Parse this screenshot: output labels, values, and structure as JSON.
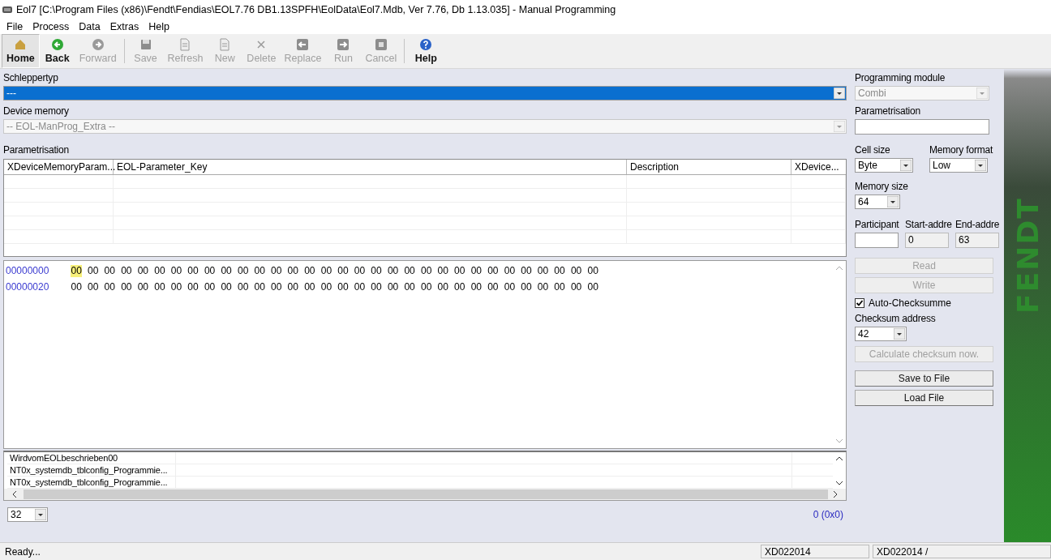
{
  "window": {
    "title": "Eol7 [C:\\Program Files (x86)\\Fendt\\Fendias\\EOL7.76 DB1.13SPFH\\EolData\\Eol7.Mdb, Ver 7.76, Db 1.13.035]  - Manual Programming"
  },
  "menu": [
    "File",
    "Process",
    "Data",
    "Extras",
    "Help"
  ],
  "toolbar": [
    {
      "kind": "home",
      "label": "Home",
      "disabled": false,
      "selected": true,
      "separator_before": false
    },
    {
      "kind": "back",
      "label": "Back",
      "disabled": false,
      "selected": false,
      "separator_before": false
    },
    {
      "kind": "forward",
      "label": "Forward",
      "disabled": true,
      "selected": false,
      "separator_before": false
    },
    {
      "kind": "save",
      "label": "Save",
      "disabled": true,
      "selected": false,
      "separator_before": true
    },
    {
      "kind": "refresh",
      "label": "Refresh",
      "disabled": true,
      "selected": false,
      "separator_before": false
    },
    {
      "kind": "new",
      "label": "New",
      "disabled": true,
      "selected": false,
      "separator_before": false
    },
    {
      "kind": "delete",
      "label": "Delete",
      "disabled": true,
      "selected": false,
      "separator_before": false
    },
    {
      "kind": "replace",
      "label": "Replace",
      "disabled": true,
      "selected": false,
      "separator_before": false
    },
    {
      "kind": "run",
      "label": "Run",
      "disabled": true,
      "selected": false,
      "separator_before": false
    },
    {
      "kind": "cancel",
      "label": "Cancel",
      "disabled": true,
      "selected": false,
      "separator_before": false
    },
    {
      "kind": "help",
      "label": "Help",
      "disabled": false,
      "selected": false,
      "separator_before": true
    }
  ],
  "schleppertyp": {
    "label": "Schleppertyp",
    "value": "---",
    "selected": true,
    "disabled": false
  },
  "device_memory": {
    "label": "Device memory",
    "value": "-- EOL-ManProg_Extra --",
    "disabled": true
  },
  "parametrisation_table": {
    "label": "Parametrisation",
    "columns": [
      "XDeviceMemoryParam...",
      "EOL-Parameter_Key",
      "Description",
      "XDevice..."
    ]
  },
  "hex_view": {
    "rows": [
      {
        "address": "00000000",
        "bytes": [
          {
            "value": "00",
            "selected": true
          },
          {
            "value": "00",
            "selected": false
          },
          {
            "value": "00",
            "selected": false
          },
          {
            "value": "00",
            "selected": false
          },
          {
            "value": "00",
            "selected": false
          },
          {
            "value": "00",
            "selected": false
          },
          {
            "value": "00",
            "selected": false
          },
          {
            "value": "00",
            "selected": false
          },
          {
            "value": "00",
            "selected": false
          },
          {
            "value": "00",
            "selected": false
          },
          {
            "value": "00",
            "selected": false
          },
          {
            "value": "00",
            "selected": false
          },
          {
            "value": "00",
            "selected": false
          },
          {
            "value": "00",
            "selected": false
          },
          {
            "value": "00",
            "selected": false
          },
          {
            "value": "00",
            "selected": false
          },
          {
            "value": "00",
            "selected": false
          },
          {
            "value": "00",
            "selected": false
          },
          {
            "value": "00",
            "selected": false
          },
          {
            "value": "00",
            "selected": false
          },
          {
            "value": "00",
            "selected": false
          },
          {
            "value": "00",
            "selected": false
          },
          {
            "value": "00",
            "selected": false
          },
          {
            "value": "00",
            "selected": false
          },
          {
            "value": "00",
            "selected": false
          },
          {
            "value": "00",
            "selected": false
          },
          {
            "value": "00",
            "selected": false
          },
          {
            "value": "00",
            "selected": false
          },
          {
            "value": "00",
            "selected": false
          },
          {
            "value": "00",
            "selected": false
          },
          {
            "value": "00",
            "selected": false
          },
          {
            "value": "00",
            "selected": false
          }
        ]
      },
      {
        "address": "00000020",
        "bytes": [
          {
            "value": "00",
            "selected": false
          },
          {
            "value": "00",
            "selected": false
          },
          {
            "value": "00",
            "selected": false
          },
          {
            "value": "00",
            "selected": false
          },
          {
            "value": "00",
            "selected": false
          },
          {
            "value": "00",
            "selected": false
          },
          {
            "value": "00",
            "selected": false
          },
          {
            "value": "00",
            "selected": false
          },
          {
            "value": "00",
            "selected": false
          },
          {
            "value": "00",
            "selected": false
          },
          {
            "value": "00",
            "selected": false
          },
          {
            "value": "00",
            "selected": false
          },
          {
            "value": "00",
            "selected": false
          },
          {
            "value": "00",
            "selected": false
          },
          {
            "value": "00",
            "selected": false
          },
          {
            "value": "00",
            "selected": false
          },
          {
            "value": "00",
            "selected": false
          },
          {
            "value": "00",
            "selected": false
          },
          {
            "value": "00",
            "selected": false
          },
          {
            "value": "00",
            "selected": false
          },
          {
            "value": "00",
            "selected": false
          },
          {
            "value": "00",
            "selected": false
          },
          {
            "value": "00",
            "selected": false
          },
          {
            "value": "00",
            "selected": false
          },
          {
            "value": "00",
            "selected": false
          },
          {
            "value": "00",
            "selected": false
          },
          {
            "value": "00",
            "selected": false
          },
          {
            "value": "00",
            "selected": false
          },
          {
            "value": "00",
            "selected": false
          },
          {
            "value": "00",
            "selected": false
          },
          {
            "value": "00",
            "selected": false
          },
          {
            "value": "00",
            "selected": false
          }
        ]
      }
    ]
  },
  "message_list": {
    "rows": [
      "WirdvomEOLbeschrieben00",
      "NT0x_systemdb_tblconfig_Programmie...",
      "NT0x_systemdb_tblconfig_Programmie..."
    ]
  },
  "bytes_per_row": {
    "value": "32"
  },
  "position": "0 (0x0)",
  "right_panel": {
    "programming_module": {
      "label": "Programming module",
      "value": "Combi",
      "disabled": true
    },
    "parametrisation": {
      "label": "Parametrisation"
    },
    "cell_size": {
      "label": "Cell size",
      "value": "Byte"
    },
    "memory_format": {
      "label": "Memory format",
      "value": "Low"
    },
    "memory_size": {
      "label": "Memory size",
      "value": "64"
    },
    "participant": {
      "label": "Participant",
      "readonly": false
    },
    "start_address": {
      "label": "Start-addre",
      "value": "0",
      "readonly": true
    },
    "end_address": {
      "label": "End-addre",
      "value": "63",
      "readonly": true
    },
    "read": {
      "label": "Read",
      "disabled": true
    },
    "write": {
      "label": "Write",
      "disabled": true
    },
    "auto_checksum": {
      "label": "Auto-Checksumme",
      "checked": true
    },
    "checksum_address": {
      "label": "Checksum address",
      "value": "42"
    },
    "calculate": {
      "label": "Calculate checksum now.",
      "disabled": true
    },
    "save_to_file": {
      "label": "Save to File",
      "disabled": false
    },
    "load_file": {
      "label": "Load File",
      "disabled": false
    }
  },
  "banner": {
    "text": "FENDT"
  },
  "status_bar": [
    "Ready...",
    "XD022014",
    "XD022014 /"
  ]
}
